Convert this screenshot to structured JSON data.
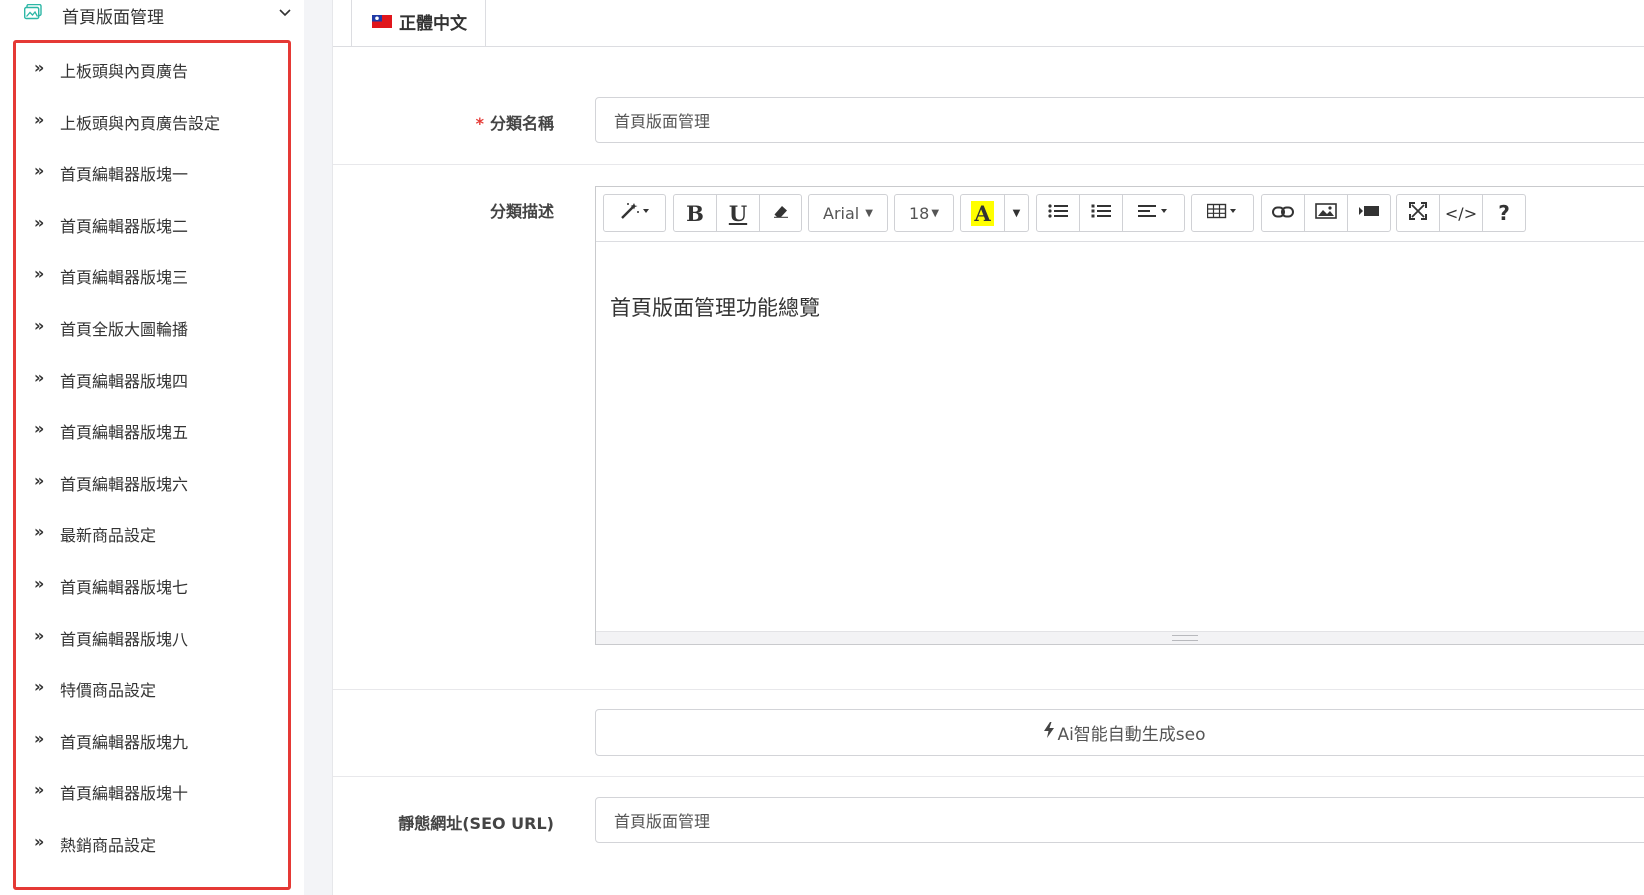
{
  "sidebar": {
    "section_title": "首頁版面管理",
    "items": [
      {
        "label": "上板頭與內頁廣告"
      },
      {
        "label": "上板頭與內頁廣告設定"
      },
      {
        "label": "首頁編輯器版塊一"
      },
      {
        "label": "首頁編輯器版塊二"
      },
      {
        "label": "首頁編輯器版塊三"
      },
      {
        "label": "首頁全版大圖輪播"
      },
      {
        "label": "首頁編輯器版塊四"
      },
      {
        "label": "首頁編輯器版塊五"
      },
      {
        "label": "首頁編輯器版塊六"
      },
      {
        "label": "最新商品設定"
      },
      {
        "label": "首頁編輯器版塊七"
      },
      {
        "label": "首頁編輯器版塊八"
      },
      {
        "label": "特價商品設定"
      },
      {
        "label": "首頁編輯器版塊九"
      },
      {
        "label": "首頁編輯器版塊十"
      },
      {
        "label": "熱銷商品設定"
      }
    ],
    "item_arrow": "»",
    "highlight_color": "#e53935"
  },
  "tabs": {
    "active_label": "正體中文"
  },
  "form": {
    "required_mark": "*",
    "category_name_label": "分類名稱",
    "category_name_value": "首頁版面管理",
    "description_label": "分類描述",
    "description_content": "首頁版面管理功能總覽",
    "toolbar": {
      "bold": "B",
      "underline": "U",
      "font_name": "Arial",
      "font_size": "18",
      "color_letter": "A",
      "help": "?",
      "code": "</>"
    },
    "ai_button_label": "Ai智能自動生成seo",
    "seo_url_label": "靜態網址(SEO URL)",
    "seo_url_value": "首頁版面管理"
  }
}
